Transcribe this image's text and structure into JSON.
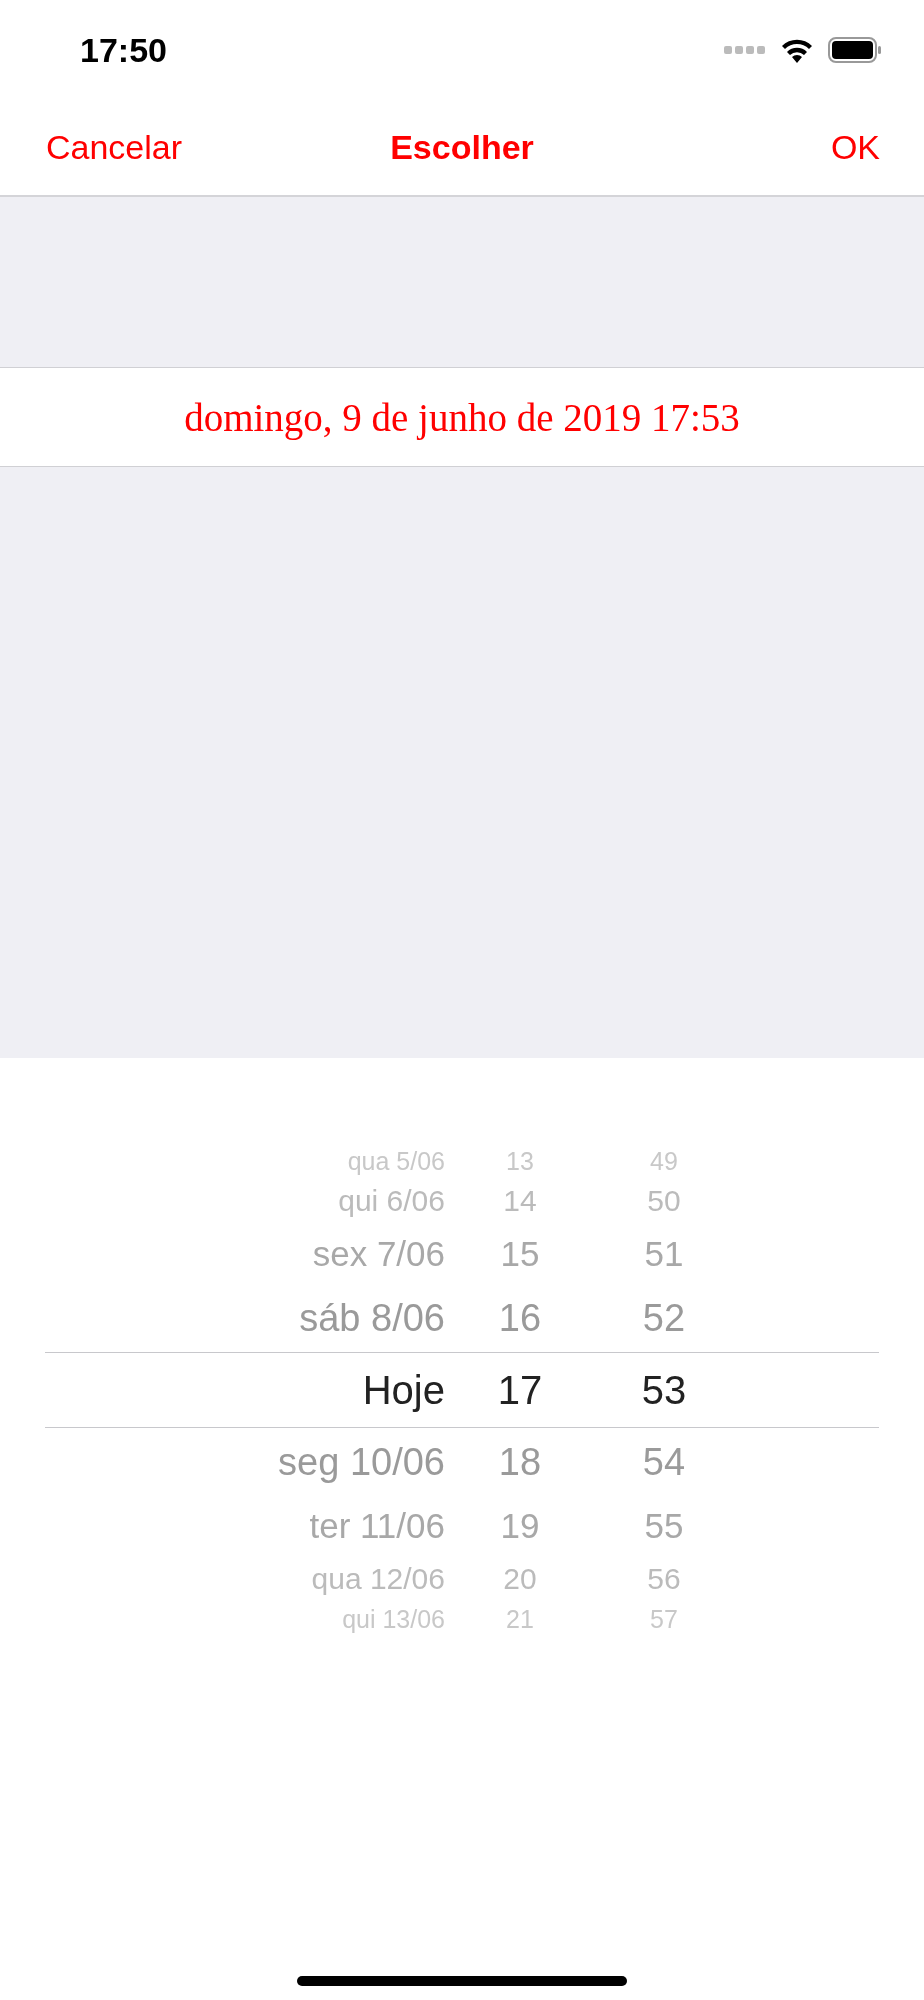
{
  "status_bar": {
    "time": "17:50"
  },
  "nav_bar": {
    "cancel": "Cancelar",
    "title": "Escolher",
    "confirm": "OK"
  },
  "selected_date": "domingo, 9 de junho de 2019 17:53",
  "picker": {
    "rows": [
      {
        "day": "qua 5/06",
        "hour": "13",
        "minute": "49",
        "selected": false
      },
      {
        "day": "qui 6/06",
        "hour": "14",
        "minute": "50",
        "selected": false
      },
      {
        "day": "sex 7/06",
        "hour": "15",
        "minute": "51",
        "selected": false
      },
      {
        "day": "sáb 8/06",
        "hour": "16",
        "minute": "52",
        "selected": false
      },
      {
        "day": "Hoje",
        "hour": "17",
        "minute": "53",
        "selected": true
      },
      {
        "day": "seg 10/06",
        "hour": "18",
        "minute": "54",
        "selected": false
      },
      {
        "day": "ter 11/06",
        "hour": "19",
        "minute": "55",
        "selected": false
      },
      {
        "day": "qua 12/06",
        "hour": "20",
        "minute": "56",
        "selected": false
      },
      {
        "day": "qui 13/06",
        "hour": "21",
        "minute": "57",
        "selected": false
      }
    ]
  }
}
